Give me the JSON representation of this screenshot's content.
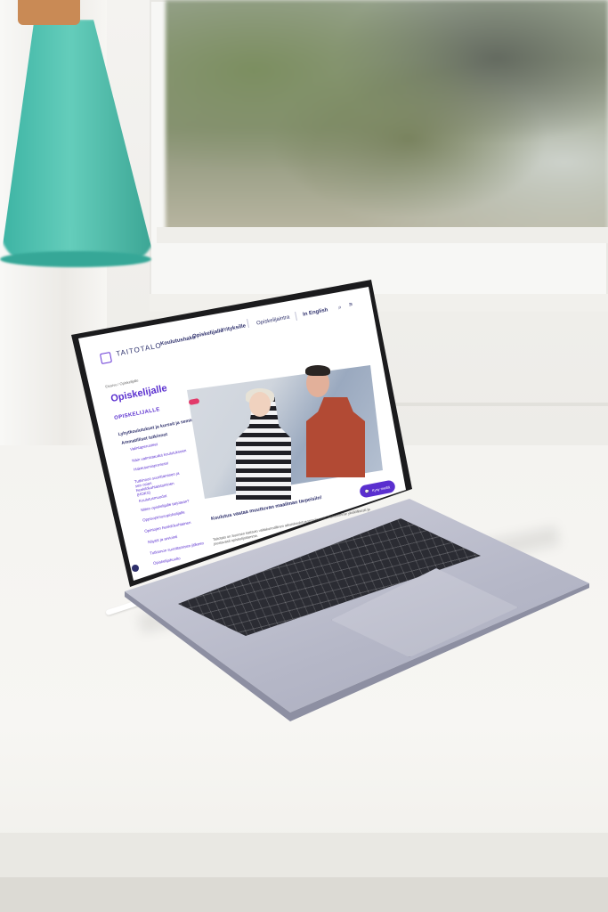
{
  "site": {
    "logo_text": "TAITOTALO",
    "nav": [
      "Koulutushaku",
      "Opiskelijalle",
      "Yrityksille"
    ],
    "student_portal": "Opiskelijaintra",
    "language_link": "In English"
  },
  "page": {
    "breadcrumb": "Etusivu / Opiskelijalle",
    "title": "Opiskelijalle",
    "sidebar_heading": "OPISKELIJALLE",
    "sidebar_sections": [
      "Lyhytkoulutukset ja kurssit ja seminaarit",
      "Ammatilliset tutkinnot"
    ],
    "sidebar_links": [
      "Valintaperusteet",
      "Näin valmistaudut koulutukseen",
      "Hakeutumisprosessi",
      "Tutkinnon suorittaminen ja sen osien henkilökohtaistaminen (HOKS)",
      "Koulutusmuodot",
      "Miten opiskelijalle tarjotaan?",
      "Oppisopimusopiskelijalle",
      "Opintojen henkilökohtainen",
      "Näytöt ja arviointi",
      "Tutkinnon suorittamisen jälkeen",
      "Opiskelijahuolto"
    ],
    "hero_heading": "Koulutus vastaa muuttuvan maailman tarpeisiin!",
    "hero_text": "Taitotalo on Suomen kattavin valtakunnallinen aikuiskoulutusorganisaatio. Palvelemme yksilöllisesti ja joustavasti opiskelijoitamme.",
    "chat_label": "Kysy meiltä"
  },
  "colors": {
    "brand_purple": "#5a2fcf",
    "brand_navy": "#2d2f6b",
    "lamp_teal": "#4cc2b1"
  }
}
